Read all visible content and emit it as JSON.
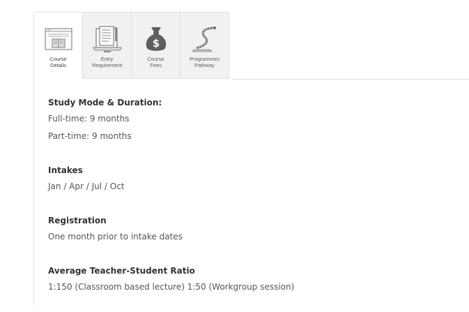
{
  "tabs": [
    {
      "label": "Course\nDetails",
      "icon": "course-details-icon",
      "active": true
    },
    {
      "label": "Entry\nRequirement",
      "icon": "entry-requirement-icon",
      "active": false
    },
    {
      "label": "Course\nFees",
      "icon": "money-bag-icon",
      "active": false
    },
    {
      "label": "Programmes\nPathway",
      "icon": "pathway-icon",
      "active": false
    }
  ],
  "sections": {
    "study_mode": {
      "heading": "Study Mode & Duration:",
      "lines": [
        "Full-time: 9 months",
        "Part-time: 9 months"
      ]
    },
    "intakes": {
      "heading": "Intakes",
      "lines": [
        "Jan / Apr / Jul / Oct"
      ]
    },
    "registration": {
      "heading": "Registration",
      "lines": [
        "One month prior to intake dates"
      ]
    },
    "ratio": {
      "heading": "Average Teacher-Student Ratio",
      "lines": [
        "1:150 (Classroom based lecture) 1:50 (Workgroup session)"
      ]
    }
  },
  "colors": {
    "tab_bg": "#f1f1f1",
    "border": "#e0e0e0",
    "heading": "#333333",
    "text": "#555555"
  }
}
